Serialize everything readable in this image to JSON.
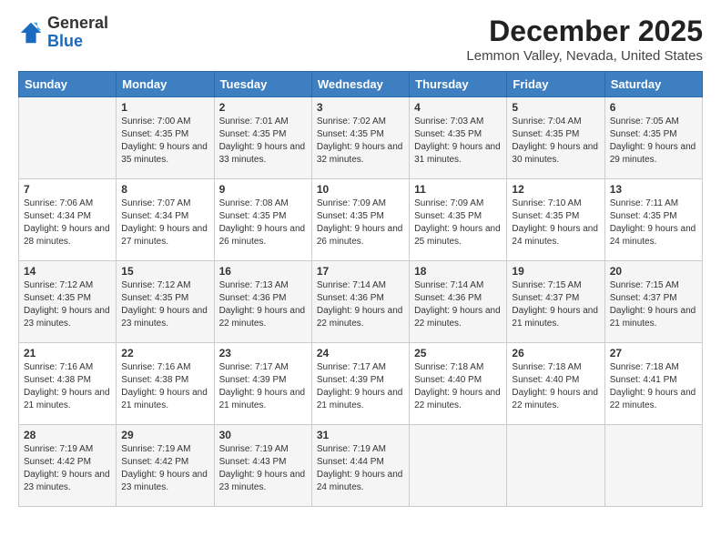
{
  "logo": {
    "line1": "General",
    "line2": "Blue"
  },
  "title": "December 2025",
  "subtitle": "Lemmon Valley, Nevada, United States",
  "days_of_week": [
    "Sunday",
    "Monday",
    "Tuesday",
    "Wednesday",
    "Thursday",
    "Friday",
    "Saturday"
  ],
  "weeks": [
    [
      {
        "day": "",
        "sunrise": "",
        "sunset": "",
        "daylight": ""
      },
      {
        "day": "1",
        "sunrise": "Sunrise: 7:00 AM",
        "sunset": "Sunset: 4:35 PM",
        "daylight": "Daylight: 9 hours and 35 minutes."
      },
      {
        "day": "2",
        "sunrise": "Sunrise: 7:01 AM",
        "sunset": "Sunset: 4:35 PM",
        "daylight": "Daylight: 9 hours and 33 minutes."
      },
      {
        "day": "3",
        "sunrise": "Sunrise: 7:02 AM",
        "sunset": "Sunset: 4:35 PM",
        "daylight": "Daylight: 9 hours and 32 minutes."
      },
      {
        "day": "4",
        "sunrise": "Sunrise: 7:03 AM",
        "sunset": "Sunset: 4:35 PM",
        "daylight": "Daylight: 9 hours and 31 minutes."
      },
      {
        "day": "5",
        "sunrise": "Sunrise: 7:04 AM",
        "sunset": "Sunset: 4:35 PM",
        "daylight": "Daylight: 9 hours and 30 minutes."
      },
      {
        "day": "6",
        "sunrise": "Sunrise: 7:05 AM",
        "sunset": "Sunset: 4:35 PM",
        "daylight": "Daylight: 9 hours and 29 minutes."
      }
    ],
    [
      {
        "day": "7",
        "sunrise": "Sunrise: 7:06 AM",
        "sunset": "Sunset: 4:34 PM",
        "daylight": "Daylight: 9 hours and 28 minutes."
      },
      {
        "day": "8",
        "sunrise": "Sunrise: 7:07 AM",
        "sunset": "Sunset: 4:34 PM",
        "daylight": "Daylight: 9 hours and 27 minutes."
      },
      {
        "day": "9",
        "sunrise": "Sunrise: 7:08 AM",
        "sunset": "Sunset: 4:35 PM",
        "daylight": "Daylight: 9 hours and 26 minutes."
      },
      {
        "day": "10",
        "sunrise": "Sunrise: 7:09 AM",
        "sunset": "Sunset: 4:35 PM",
        "daylight": "Daylight: 9 hours and 26 minutes."
      },
      {
        "day": "11",
        "sunrise": "Sunrise: 7:09 AM",
        "sunset": "Sunset: 4:35 PM",
        "daylight": "Daylight: 9 hours and 25 minutes."
      },
      {
        "day": "12",
        "sunrise": "Sunrise: 7:10 AM",
        "sunset": "Sunset: 4:35 PM",
        "daylight": "Daylight: 9 hours and 24 minutes."
      },
      {
        "day": "13",
        "sunrise": "Sunrise: 7:11 AM",
        "sunset": "Sunset: 4:35 PM",
        "daylight": "Daylight: 9 hours and 24 minutes."
      }
    ],
    [
      {
        "day": "14",
        "sunrise": "Sunrise: 7:12 AM",
        "sunset": "Sunset: 4:35 PM",
        "daylight": "Daylight: 9 hours and 23 minutes."
      },
      {
        "day": "15",
        "sunrise": "Sunrise: 7:12 AM",
        "sunset": "Sunset: 4:35 PM",
        "daylight": "Daylight: 9 hours and 23 minutes."
      },
      {
        "day": "16",
        "sunrise": "Sunrise: 7:13 AM",
        "sunset": "Sunset: 4:36 PM",
        "daylight": "Daylight: 9 hours and 22 minutes."
      },
      {
        "day": "17",
        "sunrise": "Sunrise: 7:14 AM",
        "sunset": "Sunset: 4:36 PM",
        "daylight": "Daylight: 9 hours and 22 minutes."
      },
      {
        "day": "18",
        "sunrise": "Sunrise: 7:14 AM",
        "sunset": "Sunset: 4:36 PM",
        "daylight": "Daylight: 9 hours and 22 minutes."
      },
      {
        "day": "19",
        "sunrise": "Sunrise: 7:15 AM",
        "sunset": "Sunset: 4:37 PM",
        "daylight": "Daylight: 9 hours and 21 minutes."
      },
      {
        "day": "20",
        "sunrise": "Sunrise: 7:15 AM",
        "sunset": "Sunset: 4:37 PM",
        "daylight": "Daylight: 9 hours and 21 minutes."
      }
    ],
    [
      {
        "day": "21",
        "sunrise": "Sunrise: 7:16 AM",
        "sunset": "Sunset: 4:38 PM",
        "daylight": "Daylight: 9 hours and 21 minutes."
      },
      {
        "day": "22",
        "sunrise": "Sunrise: 7:16 AM",
        "sunset": "Sunset: 4:38 PM",
        "daylight": "Daylight: 9 hours and 21 minutes."
      },
      {
        "day": "23",
        "sunrise": "Sunrise: 7:17 AM",
        "sunset": "Sunset: 4:39 PM",
        "daylight": "Daylight: 9 hours and 21 minutes."
      },
      {
        "day": "24",
        "sunrise": "Sunrise: 7:17 AM",
        "sunset": "Sunset: 4:39 PM",
        "daylight": "Daylight: 9 hours and 21 minutes."
      },
      {
        "day": "25",
        "sunrise": "Sunrise: 7:18 AM",
        "sunset": "Sunset: 4:40 PM",
        "daylight": "Daylight: 9 hours and 22 minutes."
      },
      {
        "day": "26",
        "sunrise": "Sunrise: 7:18 AM",
        "sunset": "Sunset: 4:40 PM",
        "daylight": "Daylight: 9 hours and 22 minutes."
      },
      {
        "day": "27",
        "sunrise": "Sunrise: 7:18 AM",
        "sunset": "Sunset: 4:41 PM",
        "daylight": "Daylight: 9 hours and 22 minutes."
      }
    ],
    [
      {
        "day": "28",
        "sunrise": "Sunrise: 7:19 AM",
        "sunset": "Sunset: 4:42 PM",
        "daylight": "Daylight: 9 hours and 23 minutes."
      },
      {
        "day": "29",
        "sunrise": "Sunrise: 7:19 AM",
        "sunset": "Sunset: 4:42 PM",
        "daylight": "Daylight: 9 hours and 23 minutes."
      },
      {
        "day": "30",
        "sunrise": "Sunrise: 7:19 AM",
        "sunset": "Sunset: 4:43 PM",
        "daylight": "Daylight: 9 hours and 23 minutes."
      },
      {
        "day": "31",
        "sunrise": "Sunrise: 7:19 AM",
        "sunset": "Sunset: 4:44 PM",
        "daylight": "Daylight: 9 hours and 24 minutes."
      },
      {
        "day": "",
        "sunrise": "",
        "sunset": "",
        "daylight": ""
      },
      {
        "day": "",
        "sunrise": "",
        "sunset": "",
        "daylight": ""
      },
      {
        "day": "",
        "sunrise": "",
        "sunset": "",
        "daylight": ""
      }
    ]
  ]
}
